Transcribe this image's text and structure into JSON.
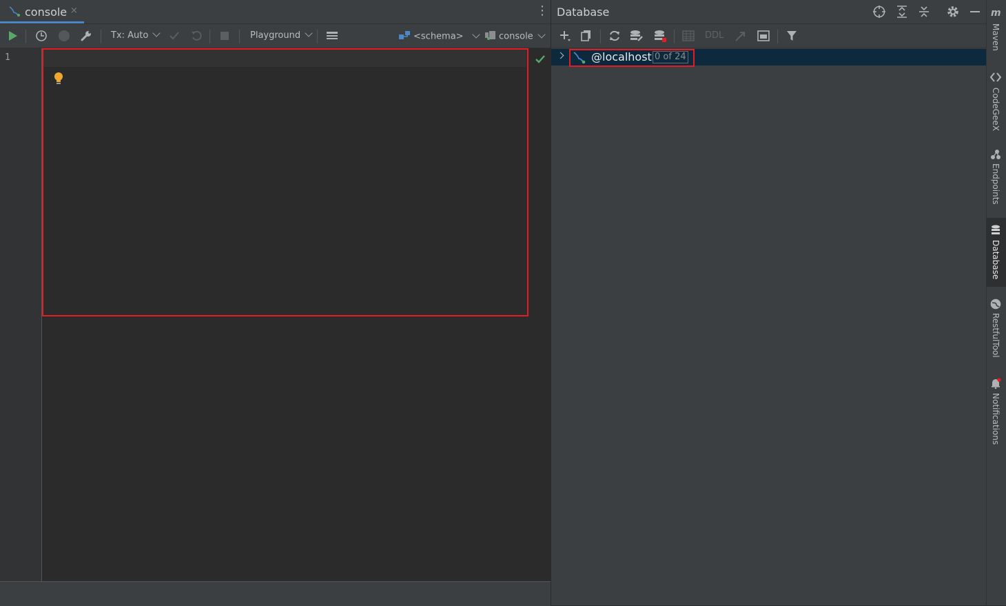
{
  "editor": {
    "tab_label": "console",
    "tab_close": "×",
    "line_number": "1",
    "toolbar": {
      "tx_label": "Tx: Auto",
      "mode_label": "Playground",
      "schema_label": "<schema>",
      "session_label": "console"
    }
  },
  "database_panel": {
    "title": "Database",
    "toolbar": {
      "ddl_label": "DDL"
    },
    "tree": [
      {
        "name": "@localhost",
        "badge": "0 of 24"
      }
    ]
  },
  "side_tabs": [
    {
      "label": "Maven",
      "icon": "maven-icon"
    },
    {
      "label": "CodeGeeX",
      "icon": "codegeex-icon"
    },
    {
      "label": "Endpoints",
      "icon": "endpoints-icon"
    },
    {
      "label": "Database",
      "icon": "database-icon"
    },
    {
      "label": "RestfulTool",
      "icon": "globe-icon"
    },
    {
      "label": "Notifications",
      "icon": "bell-icon"
    }
  ],
  "colors": {
    "accent": "#4a88c7",
    "selection": "#0d293e",
    "highlight_box": "#e51c23",
    "run_green": "#59a869"
  }
}
